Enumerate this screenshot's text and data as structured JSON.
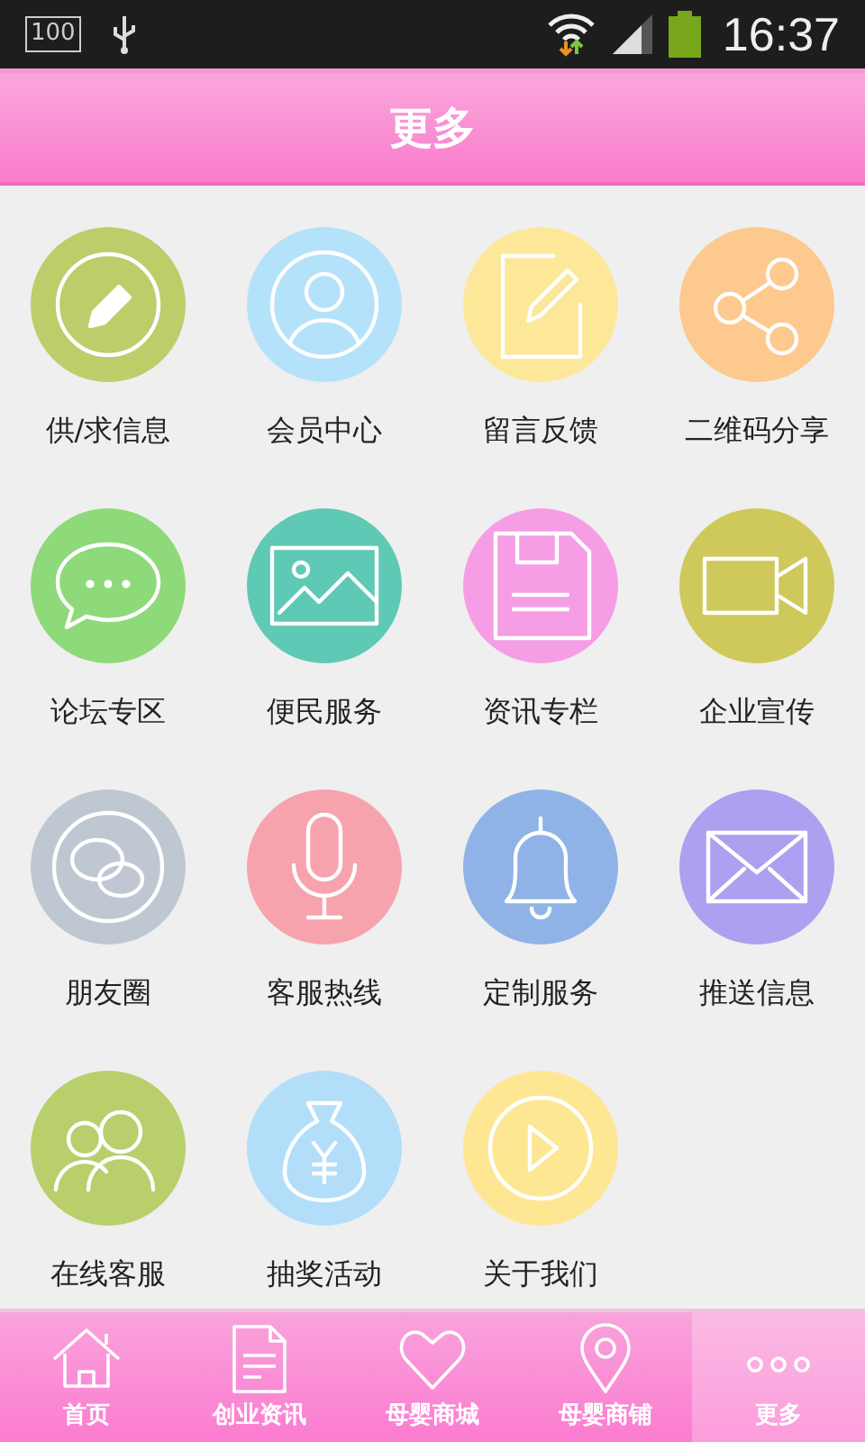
{
  "status_bar": {
    "battery_badge": "100",
    "time": "16:37"
  },
  "header": {
    "title": "更多"
  },
  "tiles": [
    {
      "label": "供/求信息",
      "kind": "pencil",
      "color": "#bccd6a"
    },
    {
      "label": "会员中心",
      "kind": "user",
      "color": "#b4e2fb"
    },
    {
      "label": "留言反馈",
      "kind": "note",
      "color": "#fde89a"
    },
    {
      "label": "二维码分享",
      "kind": "share",
      "color": "#fdc98e"
    },
    {
      "label": "论坛专区",
      "kind": "chat",
      "color": "#8ed97a"
    },
    {
      "label": "便民服务",
      "kind": "image",
      "color": "#5ec9b5"
    },
    {
      "label": "资讯专栏",
      "kind": "disk",
      "color": "#f59ee6"
    },
    {
      "label": "企业宣传",
      "kind": "video",
      "color": "#cfc85a"
    },
    {
      "label": "朋友圈",
      "kind": "bubbles",
      "color": "#bfc7d2"
    },
    {
      "label": "客服热线",
      "kind": "mic",
      "color": "#f7a3ad"
    },
    {
      "label": "定制服务",
      "kind": "bell",
      "color": "#8fb3e6"
    },
    {
      "label": "推送信息",
      "kind": "mail",
      "color": "#ae9ff0"
    },
    {
      "label": "在线客服",
      "kind": "people",
      "color": "#b8cf6c"
    },
    {
      "label": "抽奖活动",
      "kind": "moneybag",
      "color": "#b2defa"
    },
    {
      "label": "关于我们",
      "kind": "play",
      "color": "#fde792"
    }
  ],
  "nav": [
    {
      "label": "首页",
      "kind": "home",
      "selected": false
    },
    {
      "label": "创业资讯",
      "kind": "doc",
      "selected": false
    },
    {
      "label": "母婴商城",
      "kind": "heart",
      "selected": false
    },
    {
      "label": "母婴商铺",
      "kind": "pin",
      "selected": false
    },
    {
      "label": "更多",
      "kind": "dots",
      "selected": true
    }
  ]
}
